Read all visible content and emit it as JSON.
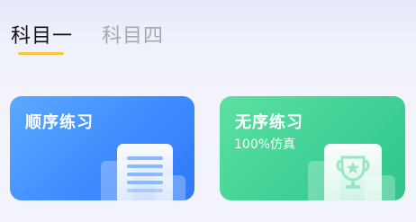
{
  "tabs": [
    {
      "label": "科目一",
      "active": true
    },
    {
      "label": "科目四",
      "active": false
    }
  ],
  "cards": [
    {
      "title": "顺序练习",
      "subtitle": "",
      "icon": "document-icon",
      "color": "#3f8cff"
    },
    {
      "title": "无序练习",
      "subtitle": "100%仿真",
      "icon": "trophy-icon",
      "color": "#40d196"
    }
  ],
  "colors": {
    "tab_underline": "#f6c541",
    "tab_active_text": "#111111",
    "tab_inactive_text": "#a7a9b0"
  }
}
